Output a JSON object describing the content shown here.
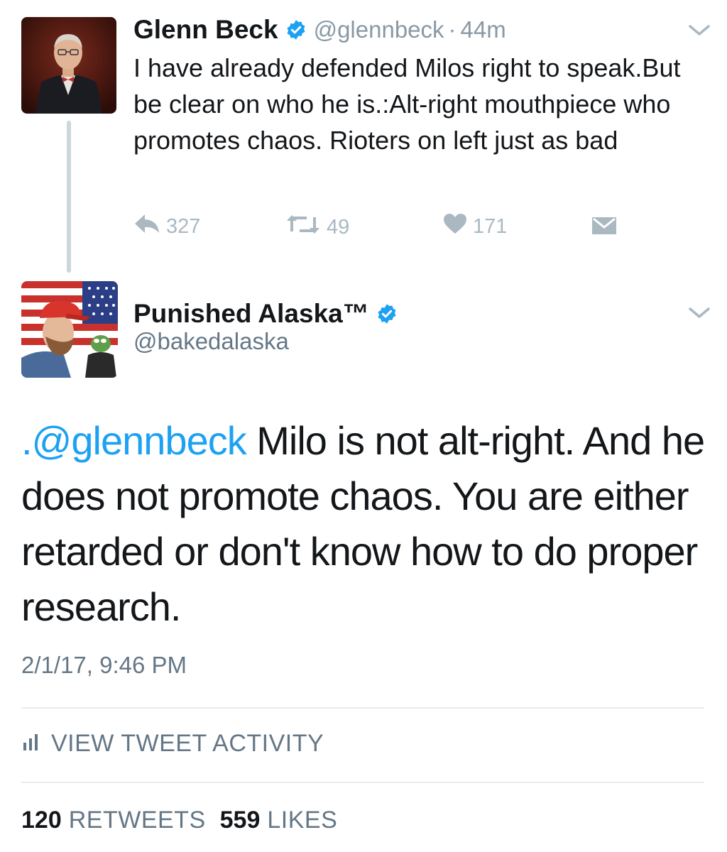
{
  "parent_tweet": {
    "display_name": "Glenn Beck",
    "handle": "@glennbeck",
    "separator": "·",
    "time": "44m",
    "text": "I have already defended Milos right to speak.But be clear on who he is.:Alt-right mouthpiece who promotes chaos. Rioters on left just as bad",
    "actions": {
      "replies": "327",
      "retweets": "49",
      "likes": "171"
    },
    "icons": [
      "verified-badge-icon",
      "chevron-down-icon",
      "reply-icon",
      "retweet-icon",
      "heart-icon",
      "envelope-icon"
    ]
  },
  "main_tweet": {
    "display_name": "Punished Alaska™",
    "handle": "@bakedalaska",
    "mention": ".@glennbeck",
    "text": " Milo is not alt-right. And he does not promote chaos. You are either retarded or don't know how to do proper research.",
    "timestamp": "2/1/17, 9:46 PM",
    "activity_label": "VIEW TWEET ACTIVITY",
    "stats": {
      "retweets_count": "120",
      "retweets_label": "RETWEETS",
      "likes_count": "559",
      "likes_label": "LIKES"
    },
    "icons": [
      "verified-badge-icon",
      "chevron-down-icon",
      "bar-chart-icon"
    ]
  },
  "colors": {
    "link_blue": "#1da1f2",
    "verified_blue": "#1da1f2",
    "muted_gray": "#657786",
    "icon_gray": "#aab8c2",
    "text": "#14171a",
    "divider": "#e6ecf0"
  }
}
